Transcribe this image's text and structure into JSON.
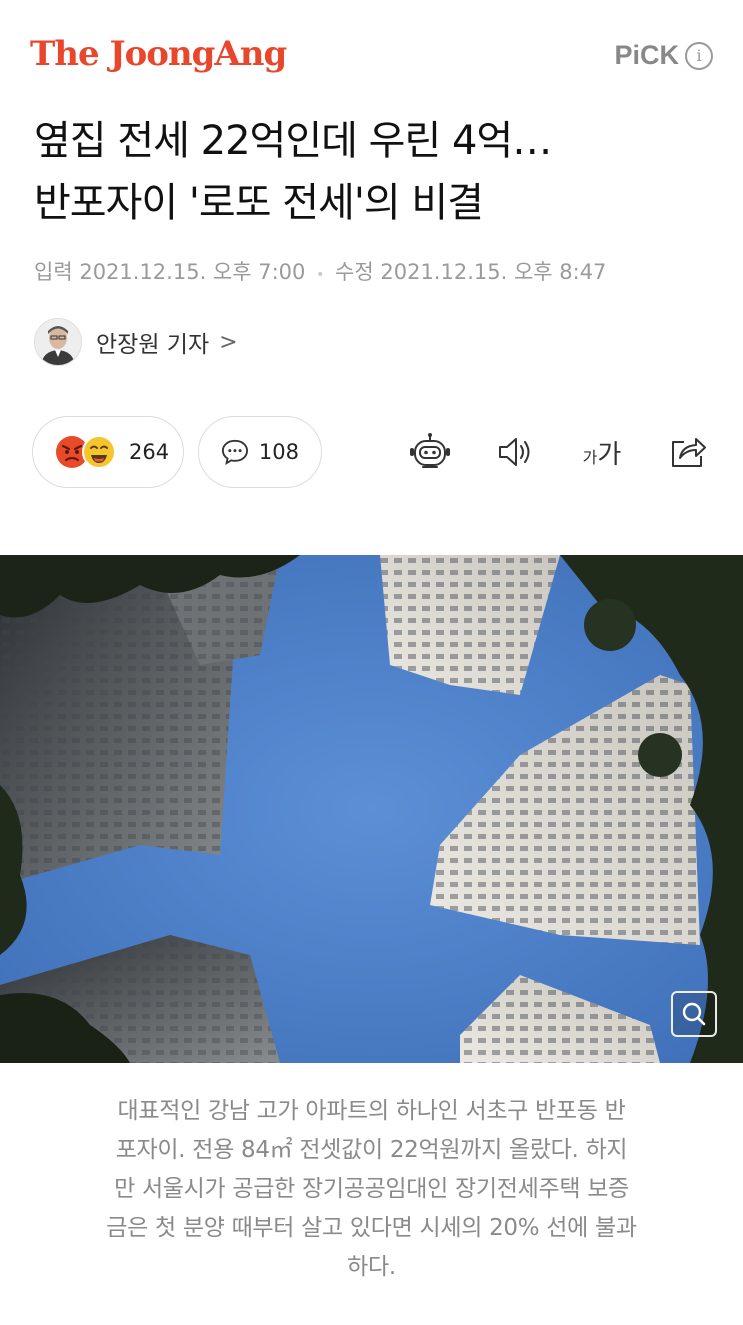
{
  "header": {
    "logo": "The JoongAng",
    "pick_label": "PiCK",
    "info_glyph": "i"
  },
  "article": {
    "headline_lines": [
      "옆집 전세 22억인데 우린 4억…",
      "반포자이 '로또 전세'의 비결"
    ],
    "input_label": "입력",
    "input_time": "2021.12.15. 오후 7:00",
    "edit_label": "수정",
    "edit_time": "2021.12.15. 오후 8:47",
    "author": "안장원 기자",
    "author_chevron": ">"
  },
  "actions": {
    "reaction_count": "264",
    "comment_count": "108",
    "font_size_small": "가",
    "font_size_large": "가",
    "icons": [
      "angry-emoji-icon",
      "grin-emoji-icon",
      "comment-icon",
      "robot-summary-icon",
      "speaker-icon",
      "share-icon",
      "zoom-icon"
    ]
  },
  "photo": {
    "caption_lines": [
      "대표적인 강남 고가 아파트의 하나인 서초구 반포동 반",
      "포자이. 전용 84㎡ 전셋값이 22억원까지 올랐다. 하지",
      "만 서울시가 공급한 장기공공임대인 장기전세주택 보증",
      "금은 첫 분양 때부터 살고 있다면 시세의 20% 선에 불과",
      "하다."
    ]
  },
  "colors": {
    "brand": "#e8472c",
    "muted_text": "#9a9a9a",
    "caption_text": "#8a8a8a",
    "sky": "#4f82c9"
  }
}
